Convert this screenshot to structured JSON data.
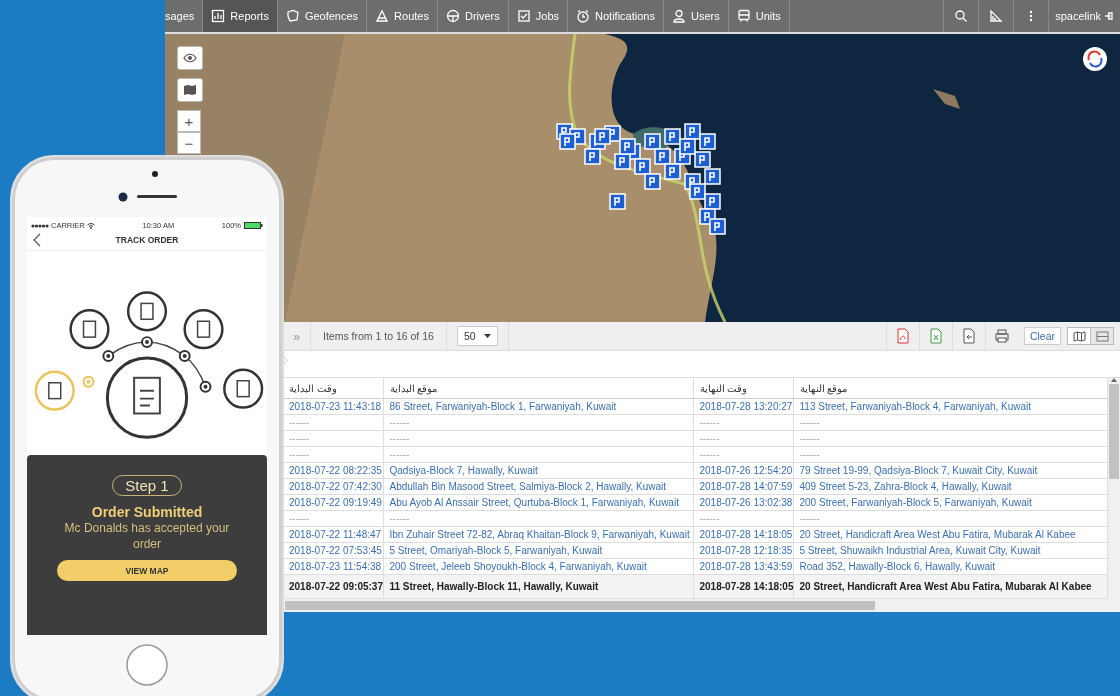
{
  "window": {
    "nav": {
      "items": [
        {
          "label": "sages",
          "selected": false
        },
        {
          "label": "Reports",
          "selected": true
        },
        {
          "label": "Geofences",
          "selected": false
        },
        {
          "label": "Routes",
          "selected": false
        },
        {
          "label": "Drivers",
          "selected": false
        },
        {
          "label": "Jobs",
          "selected": false
        },
        {
          "label": "Notifications",
          "selected": false
        },
        {
          "label": "Users",
          "selected": false
        },
        {
          "label": "Units",
          "selected": false
        }
      ],
      "user": "spacelink"
    },
    "map": {
      "zoom_in": "+",
      "zoom_out": "−"
    },
    "toolbar": {
      "expand": "»",
      "items_info": "Items from 1 to 16 of 16",
      "page_size": "50",
      "clear": "Clear"
    },
    "table": {
      "columns": [
        "وقت البداية",
        "موقع البداية",
        "وقت النهاية",
        "موقع النهاية"
      ],
      "rows": [
        {
          "kind": "record",
          "cells": [
            "2018-07-23 11:43:18",
            "86 Street, Farwaniyah-Block 1, Farwaniyah, Kuwait",
            "2018-07-28 13:20:27",
            "113 Street, Farwaniyah-Block 4, Farwaniyah, Kuwait"
          ]
        },
        {
          "kind": "empty",
          "cells": [
            "------",
            "------",
            "------",
            "------"
          ]
        },
        {
          "kind": "empty",
          "cells": [
            "------",
            "------",
            "------",
            "------"
          ]
        },
        {
          "kind": "empty",
          "cells": [
            "------",
            "------",
            "------",
            "------"
          ]
        },
        {
          "kind": "record",
          "cells": [
            "2018-07-22 08:22:35",
            "Qadsiya-Block 7, Hawally, Kuwait",
            "2018-07-26 12:54:20",
            "79 Street 19-99, Qadsiya-Block 7, Kuwait City, Kuwait"
          ]
        },
        {
          "kind": "record",
          "cells": [
            "2018-07-22 07:42:30",
            "Abdullah Bin Masood Street, Salmiya-Block 2, Hawally, Kuwait",
            "2018-07-28 14:07:59",
            "409 Street 5-23, Zahra-Block 4, Hawally, Kuwait"
          ]
        },
        {
          "kind": "record",
          "cells": [
            "2018-07-22 09:19:49",
            "Abu Ayob Al Anssair Street, Qurtuba-Block 1, Farwaniyah, Kuwait",
            "2018-07-26 13:02:38",
            "200 Street, Farwaniyah-Block 5, Farwaniyah, Kuwait"
          ]
        },
        {
          "kind": "empty",
          "cells": [
            "------",
            "------",
            "------",
            "------"
          ]
        },
        {
          "kind": "record",
          "cells": [
            "2018-07-22 11:48:47",
            "Ibn Zuhair Street 72-82, Abraq Khaitan-Block 9, Farwaniyah, Kuwait",
            "2018-07-28 14:18:05",
            "20 Street, Handicraft Area West Abu Fatira, Mubarak Al Kabee"
          ]
        },
        {
          "kind": "record",
          "cells": [
            "2018-07-22 07:53:45",
            "5 Street, Omariyah-Block 5, Farwaniyah, Kuwait",
            "2018-07-28 12:18:35",
            "5 Street, Shuwaikh Industrial Area, Kuwait City, Kuwait"
          ]
        },
        {
          "kind": "record",
          "cells": [
            "2018-07-23 11:54:38",
            "200 Street, Jeleeb Shoyoukh-Block 4, Farwaniyah, Kuwait",
            "2018-07-28 13:43:59",
            "Road 352, Hawally-Block 6, Hawally, Kuwait"
          ]
        }
      ],
      "footer": [
        "2018-07-22 09:05:37",
        "11 Street, Hawally-Block 11, Hawally, Kuwait",
        "2018-07-28 14:18:05",
        "20 Street, Handicraft Area West Abu Fatira, Mubarak Al Kabee"
      ]
    }
  },
  "phone": {
    "status": {
      "carrier": "CARRIER",
      "time": "10:30 AM",
      "battery": "100%"
    },
    "title": "TRACK ORDER",
    "steps": [
      {
        "selected": true
      },
      {
        "selected": false
      },
      {
        "selected": false
      },
      {
        "selected": false
      },
      {
        "selected": false
      }
    ],
    "card": {
      "step": "Step 1",
      "heading": "Order Submitted",
      "message": "Mc Donalds has accepted your order",
      "button": "VIEW MAP"
    }
  }
}
